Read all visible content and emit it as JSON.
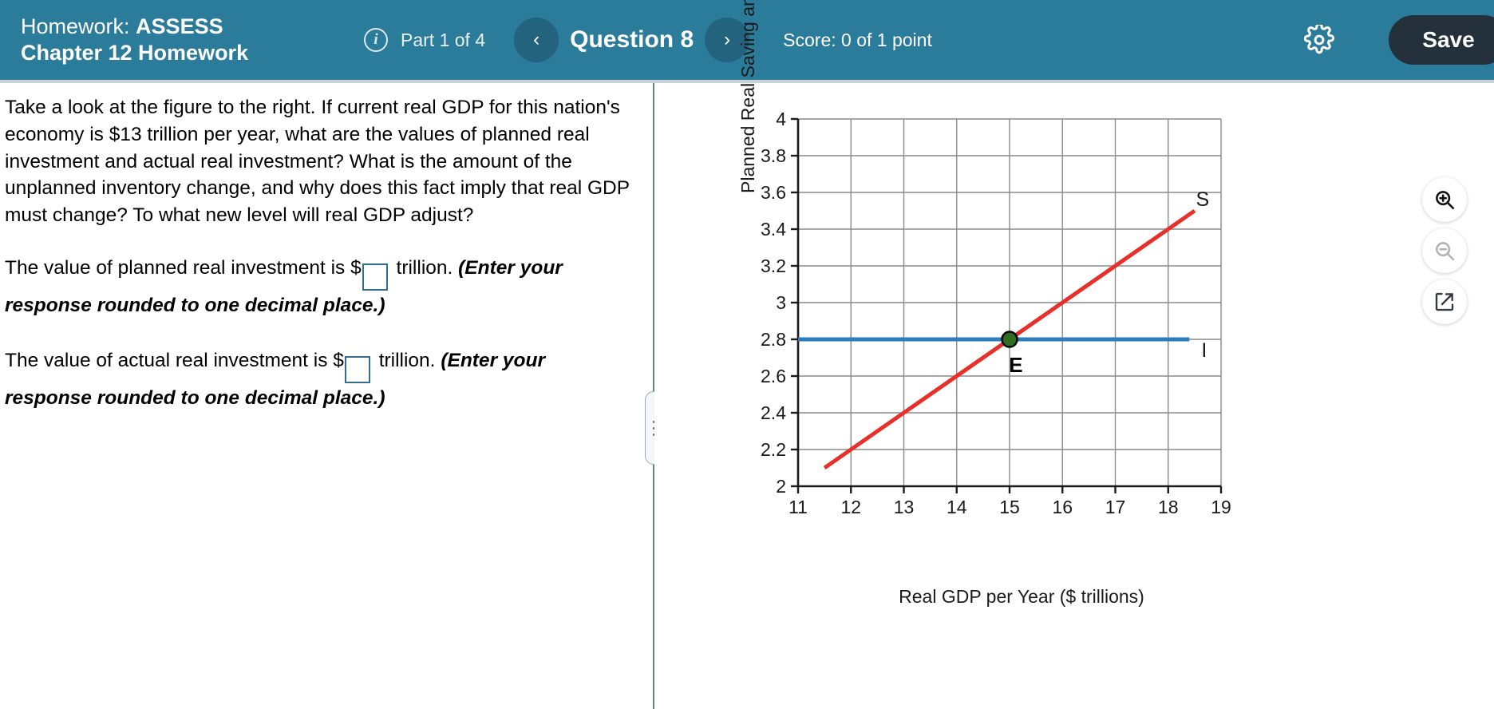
{
  "header": {
    "title_prefix": "Homework:",
    "title_assess": "ASSESS",
    "title_course": "Chapter 12 Homework",
    "info_icon": "info-icon",
    "part_label": "Part 1 of 4",
    "prev_icon": "‹",
    "next_icon": "›",
    "question_label": "Question 8",
    "score_label": "Score: 0 of 1 point",
    "gear_icon": "gear-icon",
    "save_label": "Save",
    "bg_color": "#2b7b9b",
    "nav_circle_color": "#24637d",
    "save_bg_color": "#24303c"
  },
  "question": {
    "body": "Take a look at the figure to the right. If current real GDP for this nation's economy is $13 trillion per year, what are the values of planned real investment and actual real investment? What is the amount of the unplanned inventory change, and why does this fact imply that real GDP must change? To what new level will real GDP adjust?",
    "answers": [
      {
        "prefix": "The value of planned real investment is $",
        "value": "",
        "suffix": " trillion.",
        "hint": "(Enter your response rounded to one decimal place.)",
        "box_border_color": "#336e8e"
      },
      {
        "prefix": "The value of actual real investment is $",
        "value": "",
        "suffix": " trillion.",
        "hint": "(Enter your response rounded to one decimal place.)",
        "box_border_color": "#336e8e"
      }
    ]
  },
  "toolbar": {
    "zoom_in_icon": "zoom-in-icon",
    "zoom_out_icon": "zoom-out-icon",
    "popout_icon": "popout-icon"
  },
  "chart_data": {
    "type": "line",
    "title": "",
    "xlabel": "Real GDP per Year ($ trillions)",
    "ylabel": "Planned Real Saving and Investment/Year ($ trillions)",
    "xlim": [
      11,
      19
    ],
    "ylim": [
      2,
      4
    ],
    "xticks": [
      11,
      12,
      13,
      14,
      15,
      16,
      17,
      18,
      19
    ],
    "yticks": [
      2,
      2.2,
      2.4,
      2.6,
      2.8,
      3,
      3.2,
      3.4,
      3.6,
      3.8,
      4
    ],
    "ytick_labels": [
      "2",
      "2.2",
      "2.4",
      "2.6",
      "2.8",
      "3",
      "3.2",
      "3.4",
      "3.6",
      "3.8",
      "4"
    ],
    "xtick_labels": [
      "11",
      "12",
      "13",
      "14",
      "15",
      "16",
      "17",
      "18",
      "19"
    ],
    "grid": true,
    "legend_position": "inline-labels",
    "series": [
      {
        "name": "S",
        "label": "S",
        "color": "#e8302a",
        "type": "line",
        "x": [
          11.5,
          18.5
        ],
        "y": [
          2.1,
          3.5
        ],
        "label_x": 18.65,
        "label_y": 3.56
      },
      {
        "name": "I",
        "label": "I",
        "color": "#2e7cc0",
        "type": "line",
        "x": [
          11,
          18.4
        ],
        "y": [
          2.8,
          2.8
        ],
        "label_x": 18.68,
        "label_y": 2.74
      }
    ],
    "points": [
      {
        "name": "E",
        "label": "E",
        "x": 15,
        "y": 2.8,
        "color": "#2f6e1f",
        "edge_color": "#000000",
        "label_x": 15.12,
        "label_y": 2.66
      }
    ]
  }
}
